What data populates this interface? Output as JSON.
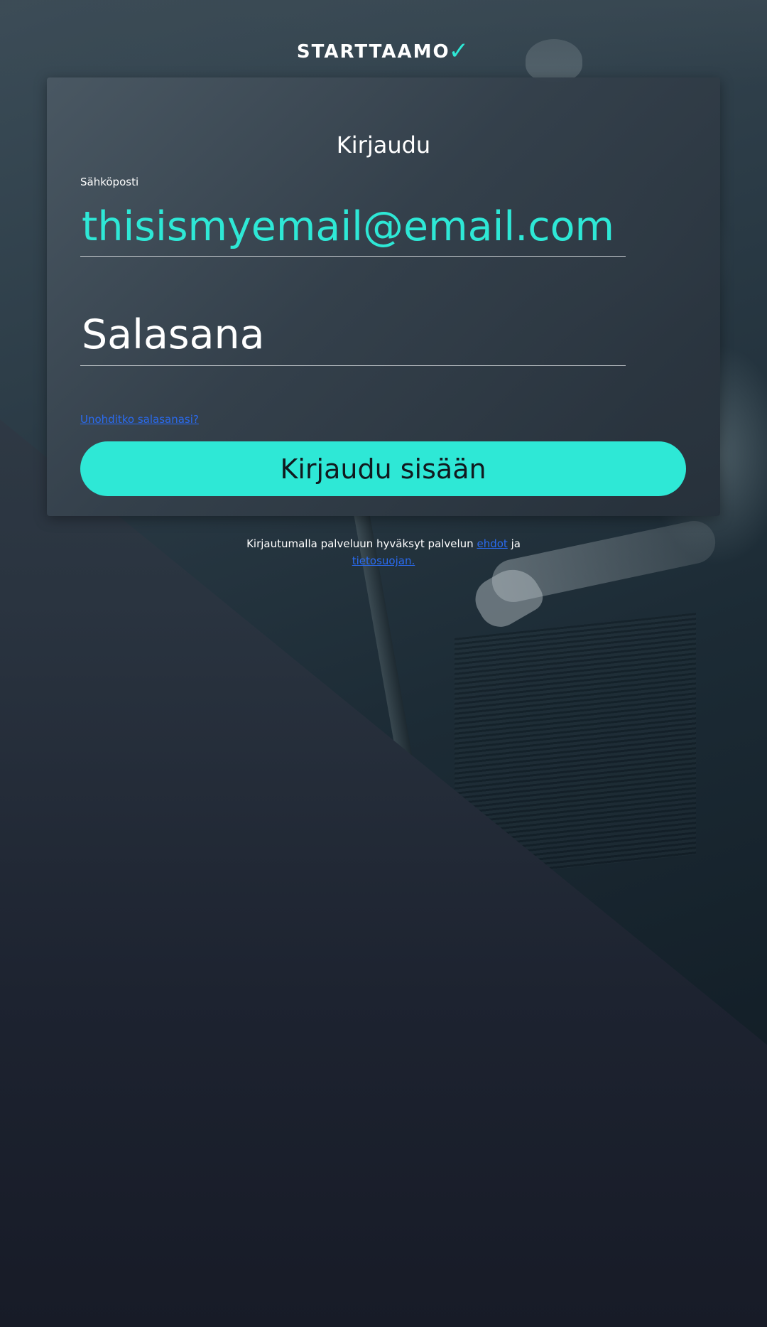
{
  "brand": {
    "logo_text": "STARTTAAMO",
    "logo_mark": "✓",
    "accent_color": "#2ee8d6",
    "link_color": "#2a6bf0"
  },
  "login": {
    "title": "Kirjaudu",
    "email_label": "Sähköposti",
    "email_value": "thisismyemail@email.com",
    "password_placeholder": "Salasana",
    "forgot_password": "Unohditko salasanasi?",
    "submit_label": "Kirjaudu sisään"
  },
  "terms": {
    "prefix": "Kirjautumalla palveluun hyväksyt palvelun",
    "terms_link": "ehdot",
    "conjunction": "ja",
    "privacy_link": "tietosuojan."
  }
}
